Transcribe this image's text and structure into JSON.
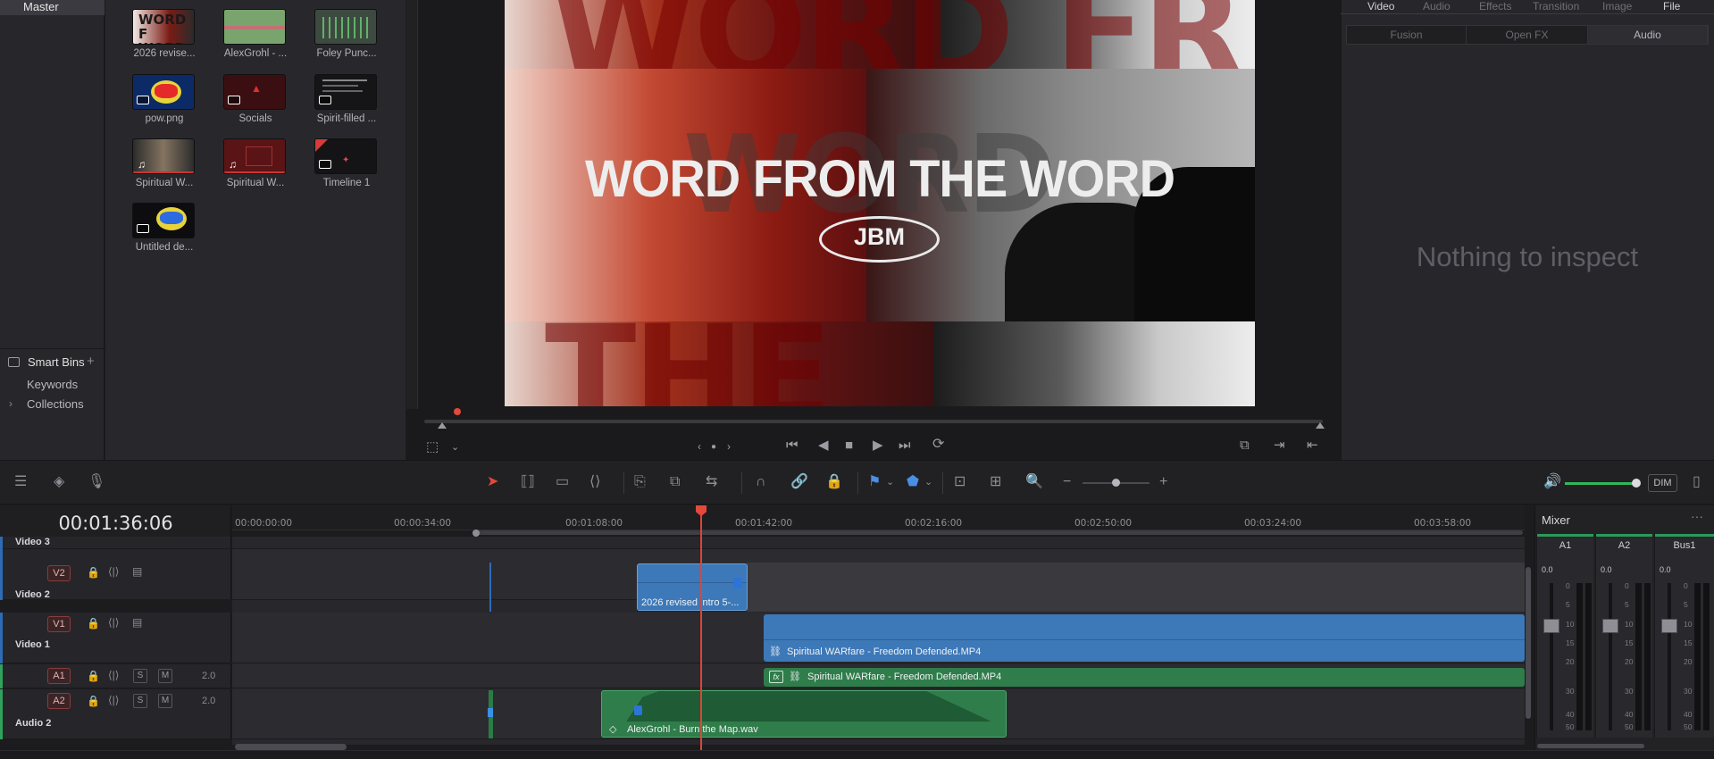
{
  "media": {
    "master_label": "Master",
    "clips": [
      {
        "name": "2026 revise...",
        "kind": "video"
      },
      {
        "name": "AlexGrohl - ...",
        "kind": "audio"
      },
      {
        "name": "Foley Punc...",
        "kind": "audio"
      },
      {
        "name": "pow.png",
        "kind": "image"
      },
      {
        "name": "Socials",
        "kind": "compound"
      },
      {
        "name": "Spirit-filled ...",
        "kind": "image"
      },
      {
        "name": "Spiritual W...",
        "kind": "video"
      },
      {
        "name": "Spiritual W...",
        "kind": "video"
      },
      {
        "name": "Timeline 1",
        "kind": "timeline"
      },
      {
        "name": "Untitled de...",
        "kind": "image"
      }
    ],
    "smart_bins_label": "Smart Bins",
    "keywords_label": "Keywords",
    "collections_label": "Collections"
  },
  "viewer": {
    "overlay_title": "WORD FROM THE WORD",
    "overlay_badge": "JBM",
    "bg_text_top": "WORD FR",
    "bg_text_bottom": "THE WORD",
    "ghost_text": "WORD"
  },
  "inspector": {
    "tabs": [
      "Video",
      "Audio",
      "Effects",
      "Transition",
      "Image",
      "File"
    ],
    "subtabs": [
      "Fusion",
      "Open FX",
      "Audio"
    ],
    "empty_text": "Nothing to inspect"
  },
  "toolbar": {
    "dim_label": "DIM"
  },
  "timeline": {
    "timecode": "00:01:36:06",
    "ruler_ticks": [
      "00:00:00:00",
      "00:00:34:00",
      "00:01:08:00",
      "00:01:42:00",
      "00:02:16:00",
      "00:02:50:00",
      "00:03:24:00",
      "00:03:58:00"
    ],
    "tracks": {
      "video3": {
        "name": "Video 3"
      },
      "video2": {
        "id": "V2",
        "name": "Video 2"
      },
      "video1": {
        "id": "V1",
        "name": "Video 1"
      },
      "audio1": {
        "id": "A1",
        "level": "2.0",
        "solo": "S",
        "mute": "M"
      },
      "audio2": {
        "id": "A2",
        "name": "Audio 2",
        "level": "2.0",
        "solo": "S",
        "mute": "M"
      }
    },
    "clips": {
      "v2_clip": "2026 revised intro 5-...",
      "v1_clip": "Spiritual WARfare - Freedom Defended.MP4",
      "a1_clip": "Spiritual WARfare - Freedom Defended.MP4",
      "a2_clip": "AlexGrohl - Burn the Map.wav"
    },
    "fx_badge": "fx"
  },
  "mixer": {
    "title": "Mixer",
    "channels": [
      {
        "name": "A1",
        "db": "0.0"
      },
      {
        "name": "A2",
        "db": "0.0"
      },
      {
        "name": "Bus1",
        "db": "0.0"
      }
    ],
    "scale": [
      "0",
      "5",
      "10",
      "15",
      "20",
      "30",
      "40",
      "50"
    ]
  }
}
